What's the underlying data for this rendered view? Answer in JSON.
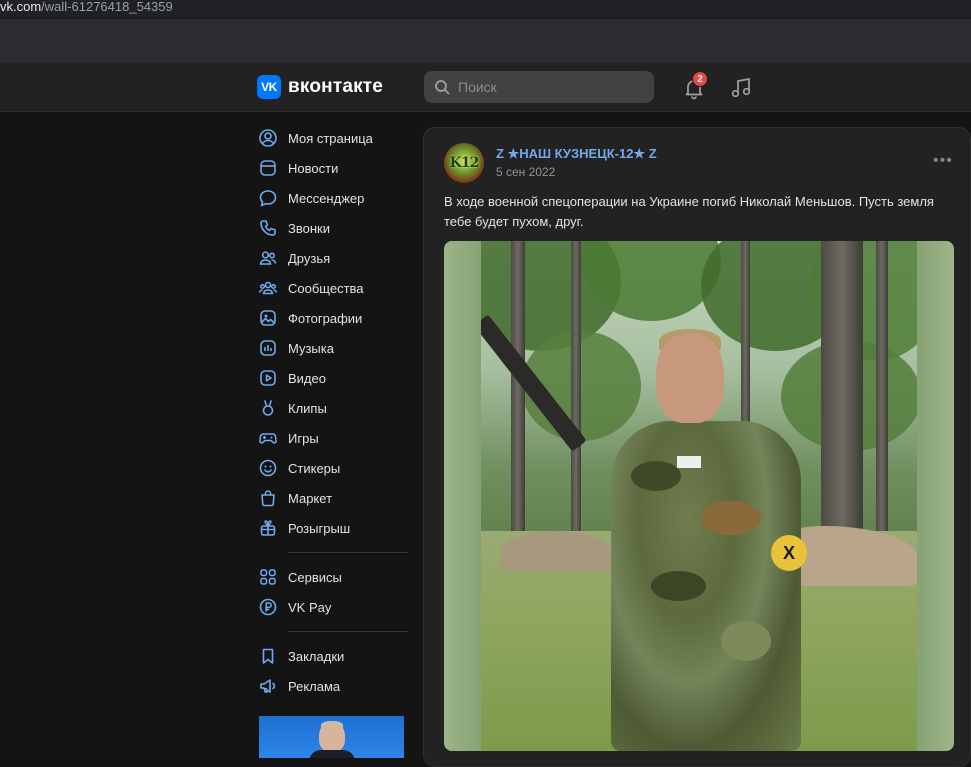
{
  "browser": {
    "url_host": "vk.com",
    "url_path": "/wall-61276418_54359"
  },
  "header": {
    "logo_mark": "VK",
    "logo_text": "вконтакте",
    "search_placeholder": "Поиск",
    "notifications_count": "2",
    "icons": [
      "search-icon",
      "bell-icon",
      "music-icon"
    ]
  },
  "nav": {
    "items": [
      {
        "label": "Моя страница",
        "icon": "user-circle-icon"
      },
      {
        "label": "Новости",
        "icon": "news-icon"
      },
      {
        "label": "Мессенджер",
        "icon": "message-icon"
      },
      {
        "label": "Звонки",
        "icon": "phone-icon"
      },
      {
        "label": "Друзья",
        "icon": "friends-icon"
      },
      {
        "label": "Сообщества",
        "icon": "communities-icon"
      },
      {
        "label": "Фотографии",
        "icon": "photo-icon"
      },
      {
        "label": "Музыка",
        "icon": "music-icon"
      },
      {
        "label": "Видео",
        "icon": "video-icon"
      },
      {
        "label": "Клипы",
        "icon": "clips-icon"
      },
      {
        "label": "Игры",
        "icon": "gamepad-icon"
      },
      {
        "label": "Стикеры",
        "icon": "smile-icon"
      },
      {
        "label": "Маркет",
        "icon": "bag-icon"
      },
      {
        "label": "Розыгрыш",
        "icon": "gift-icon"
      }
    ],
    "items2": [
      {
        "label": "Сервисы",
        "icon": "services-icon"
      },
      {
        "label": "VK Pay",
        "icon": "ruble-icon"
      }
    ],
    "items3": [
      {
        "label": "Закладки",
        "icon": "bookmark-icon"
      },
      {
        "label": "Реклама",
        "icon": "megaphone-icon"
      }
    ]
  },
  "post": {
    "avatar_text": "K12",
    "author": "Z ★НАШ КУЗНЕЦК-12★ Z",
    "date": "5 сен 2022",
    "more": "•••",
    "text": "В ходе военной спецоперации на Украине погиб Николай Меньшов. Пусть земля тебе будет пухом, друг.",
    "armband_mark": "X"
  },
  "colors": {
    "accent": "#0077ff",
    "link": "#71aaeb",
    "badge": "#e64646",
    "background": "#141414",
    "panel": "#222222"
  }
}
